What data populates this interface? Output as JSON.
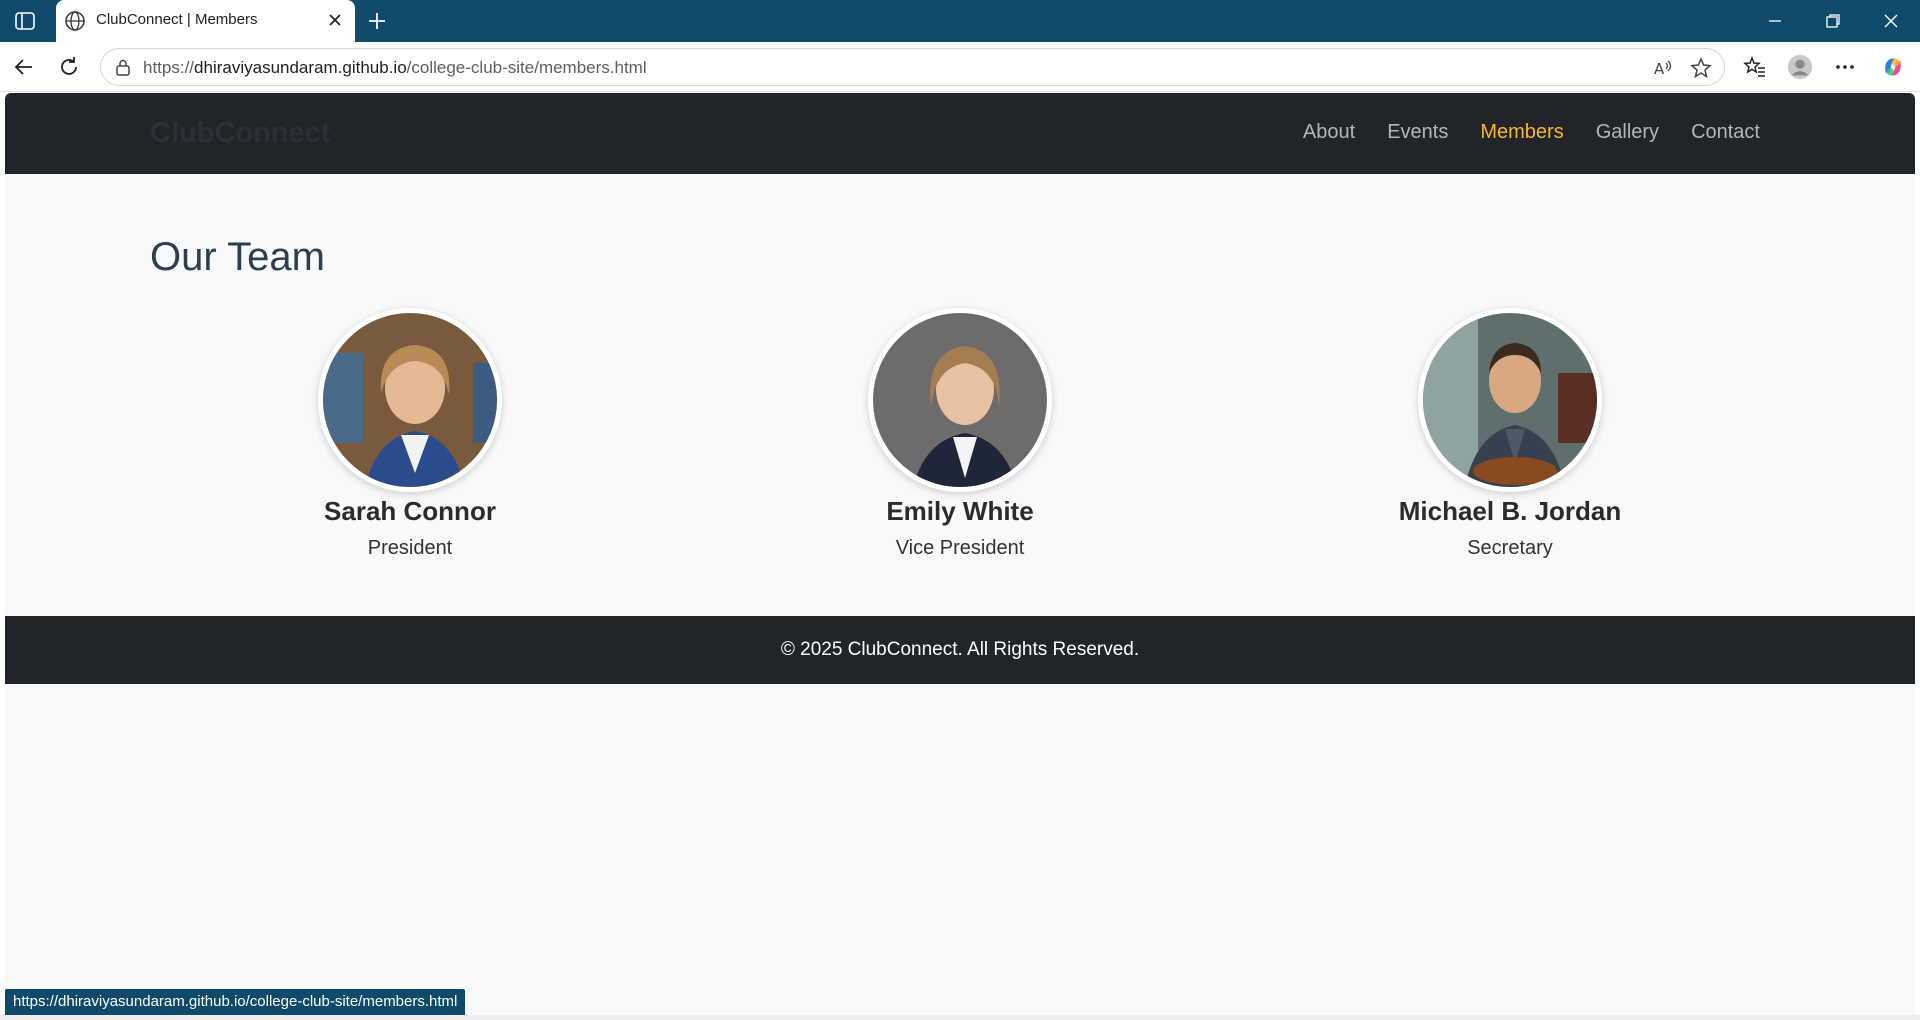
{
  "browser": {
    "tab_title": "ClubConnect | Members",
    "url_prefix": "https://",
    "url_host": "dhiraviyasundaram.github.io",
    "url_path": "/college-club-site/members.html",
    "status_url": "https://dhiraviyasundaram.github.io/college-club-site/members.html"
  },
  "site": {
    "brand": "ClubConnect",
    "nav": [
      {
        "label": "About",
        "active": false
      },
      {
        "label": "Events",
        "active": false
      },
      {
        "label": "Members",
        "active": true
      },
      {
        "label": "Gallery",
        "active": false
      },
      {
        "label": "Contact",
        "active": false
      }
    ],
    "accent_color": "#f7b928",
    "header_color": "#212529"
  },
  "team": {
    "title": "Our Team",
    "members": [
      {
        "name": "Sarah Connor",
        "role": "President"
      },
      {
        "name": "Emily White",
        "role": "Vice President"
      },
      {
        "name": "Michael B. Jordan",
        "role": "Secretary"
      }
    ]
  },
  "footer": {
    "text": "© 2025 ClubConnect. All Rights Reserved."
  }
}
